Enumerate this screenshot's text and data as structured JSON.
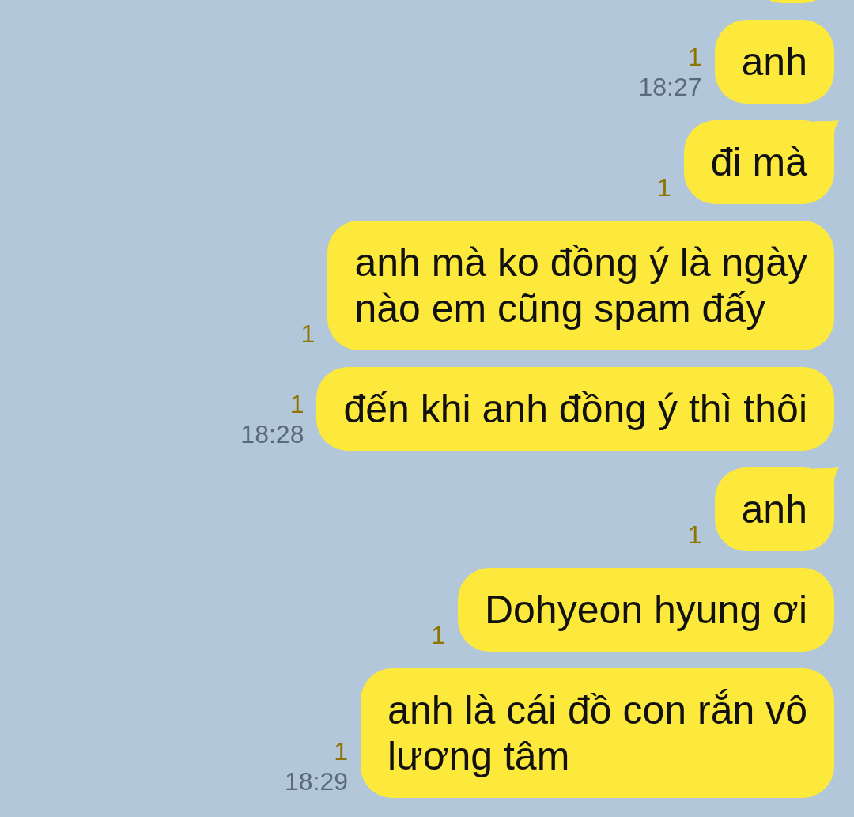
{
  "chat": {
    "messages": [
      {
        "kind": "cut_off"
      },
      {
        "kind": "text",
        "text": "anh",
        "tail": false,
        "read_count": "1",
        "time": "18:27"
      },
      {
        "kind": "text",
        "text": "đi mà",
        "tail": true,
        "read_count": "1"
      },
      {
        "kind": "text",
        "text": "anh mà ko đồng ý là ngày\nnào em cũng spam đấy",
        "tail": false,
        "read_count": "1"
      },
      {
        "kind": "text",
        "text": "đến khi anh đồng ý thì thôi",
        "tail": false,
        "read_count": "1",
        "time": "18:28"
      },
      {
        "kind": "text",
        "text": "anh",
        "tail": true,
        "read_count": "1"
      },
      {
        "kind": "text",
        "text": "Dohyeon hyung ơi",
        "tail": false,
        "read_count": "1"
      },
      {
        "kind": "text",
        "text": "anh là cái đồ con rắn vô\nlương tâm",
        "tail": false,
        "read_count": "1",
        "time": "18:29"
      }
    ]
  }
}
